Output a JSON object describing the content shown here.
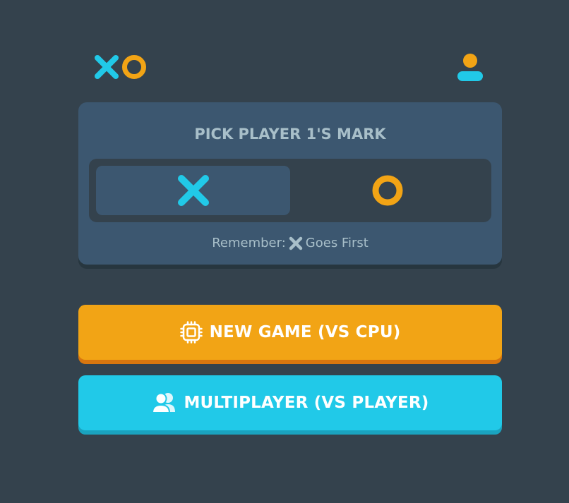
{
  "app": {
    "logo_icons": [
      "x-mark-icon",
      "o-mark-icon"
    ],
    "profile_icon": "user-icon"
  },
  "mark_picker": {
    "title": "PICK PLAYER 1'S MARK",
    "options": [
      {
        "mark": "X",
        "icon": "x-mark-icon",
        "selected": true
      },
      {
        "mark": "O",
        "icon": "o-mark-icon",
        "selected": false
      }
    ],
    "reminder_prefix": "Remember:",
    "reminder_suffix": "Goes First",
    "reminder_icon": "x-mark-icon"
  },
  "buttons": {
    "vs_cpu_label": "NEW GAME (VS CPU)",
    "vs_cpu_icon": "cpu-chip-icon",
    "vs_player_label": "MULTIPLAYER (VS PLAYER)",
    "vs_player_icon": "users-icon"
  },
  "colors": {
    "background": "#34424d",
    "card": "#3c5770",
    "x_mark": "#21c9e8",
    "o_mark": "#f2a415",
    "muted_text": "#a8bfc9"
  }
}
